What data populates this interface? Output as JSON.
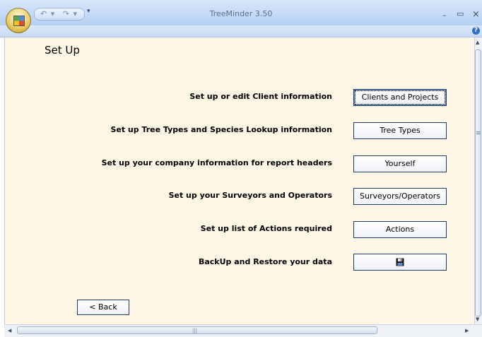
{
  "window": {
    "title": "TreeMinder 3.50",
    "minimize_glyph": "–",
    "restore_glyph": "▭",
    "close_glyph": "×",
    "help_glyph": "?"
  },
  "quick_access": {
    "undo_glyph": "↶",
    "redo_glyph": "↷",
    "dropdown_glyph": "▾",
    "customize_glyph": "▾"
  },
  "page": {
    "title": "Set Up"
  },
  "rows": [
    {
      "label": "Set up or edit Client information",
      "button": "Clients and Projects",
      "focused": true
    },
    {
      "label": "Set up Tree Types and Species Lookup information",
      "button": "Tree Types"
    },
    {
      "label": "Set up your company information for report headers",
      "button": "Yourself"
    },
    {
      "label": "Set up your Surveyors and Operators",
      "button": "Surveyors/Operators"
    },
    {
      "label": "Set up list of Actions required",
      "button": "Actions"
    },
    {
      "label": "BackUp and Restore your data",
      "button_icon": "floppy-disk-icon"
    }
  ],
  "back_button": {
    "label": "< Back"
  },
  "scrollbars": {
    "up_glyph": "▲",
    "down_glyph": "▼",
    "left_glyph": "◀",
    "right_glyph": "▶",
    "v_grip": "≡",
    "h_grip": "|||"
  },
  "colors": {
    "form_background": "#fdf6e4",
    "title_bar": "#c4daf7"
  }
}
